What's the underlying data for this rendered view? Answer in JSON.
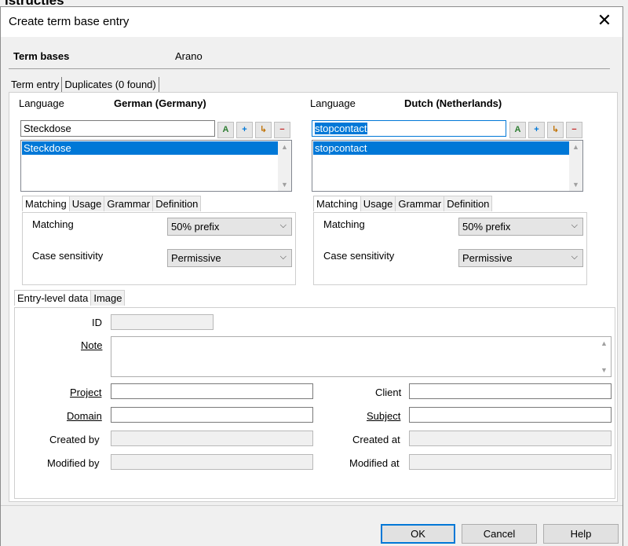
{
  "background": {
    "heading": "istructies"
  },
  "dialog": {
    "title": "Create term base entry",
    "close_glyph": "✕",
    "term_bases_label": "Term bases",
    "term_bases_value": "Arano",
    "top_tabs": [
      "Term entry",
      "Duplicates (0 found)"
    ],
    "left": {
      "language_label": "Language",
      "language_value": "German (Germany)",
      "term_input": "Steckdose",
      "list_items": [
        "Steckdose"
      ],
      "tabs": [
        "Matching",
        "Usage",
        "Grammar",
        "Definition"
      ],
      "matching_label": "Matching",
      "matching_value": "50% prefix",
      "case_label": "Case sensitivity",
      "case_value": "Permissive"
    },
    "right": {
      "language_label": "Language",
      "language_value": "Dutch (Netherlands)",
      "term_input": "stopcontact",
      "list_items": [
        "stopcontact"
      ],
      "tabs": [
        "Matching",
        "Usage",
        "Grammar",
        "Definition"
      ],
      "matching_label": "Matching",
      "matching_value": "50% prefix",
      "case_label": "Case sensitivity",
      "case_value": "Permissive"
    },
    "entry_tabs": [
      "Entry-level data",
      "Image"
    ],
    "fields": {
      "id": "ID",
      "note": "Note",
      "project": "Project",
      "domain": "Domain",
      "created_by": "Created by",
      "modified_by": "Modified by",
      "client": "Client",
      "subject": "Subject",
      "created_at": "Created at",
      "modified_at": "Modified at"
    },
    "buttons": {
      "ok": "OK",
      "cancel": "Cancel",
      "help": "Help"
    },
    "icons": [
      "add-term-icon",
      "insert-icon",
      "move-icon",
      "remove-icon"
    ],
    "accent_color": "#0078d7"
  }
}
